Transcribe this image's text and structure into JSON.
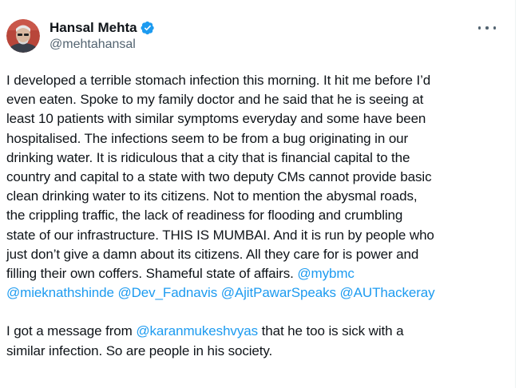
{
  "author": {
    "display_name": "Hansal Mehta",
    "handle": "@mehtahansal",
    "verified_color": "#1d9bf0"
  },
  "icons": {
    "verified": "verified-badge-icon",
    "more": "more-options-icon"
  },
  "tweet": {
    "line1": "I developed a terrible stomach infection this morning. It hit me before I’d",
    "line2": "even eaten. Spoke to my family doctor and he said that he is seeing at",
    "line3": "least 10 patients with similar symptoms everyday and some have been",
    "line4": "hospitalised. The infections seem to be from a bug originating in our",
    "line5": "drinking water. It is ridiculous that a city that is financial capital to the",
    "line6": "country and capital to a state with two deputy CMs cannot provide basic",
    "line7": "clean drinking water to its citizens. Not to mention the abysmal roads,",
    "line8": "the crippling traffic, the lack of readiness for flooding and crumbling",
    "line9": "state of our infrastructure. THIS IS MUMBAI. And it is run by people who",
    "line10": "just don’t give a damn about its citizens. All they care for is power and",
    "line11_text": "filling their own coffers. Shameful state of affairs. ",
    "mention_mybmc": "@mybmc",
    "mention_shinde": "@mieknathshinde",
    "mention_fadnavis": "@Dev_Fadnavis",
    "mention_pawar": "@AjitPawarSpeaks",
    "mention_thackeray": "@AUThackeray",
    "line14_before": "I got a message from ",
    "mention_karan": "@karanmukeshvyas",
    "line14_after": " that he too is sick with a",
    "line15": "similar infection. So are people in his society."
  },
  "colors": {
    "link": "#1d9bf0",
    "text": "#0f1419",
    "secondary": "#536471"
  }
}
